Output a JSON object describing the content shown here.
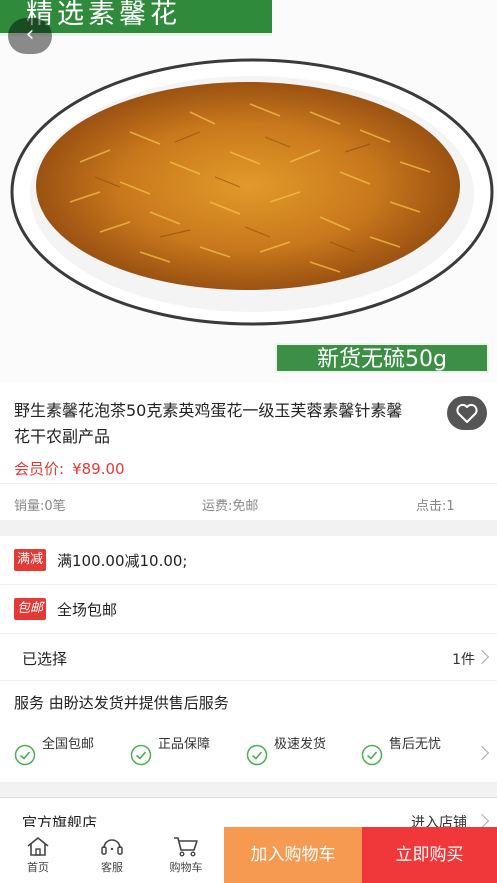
{
  "hero": {
    "banner_text": "精选素馨花",
    "caption": "新货无硫50g"
  },
  "product": {
    "title": "野生素馨花泡茶50克素英鸡蛋花一级玉芙蓉素馨针素馨花干农副产品",
    "price_label": "会员价:",
    "price_value": "¥89.00",
    "sales": "销量:0笔",
    "shipping": "运费:免邮",
    "clicks": "点击:1"
  },
  "promos": [
    {
      "tag": "满减",
      "text": "满100.00减10.00;"
    },
    {
      "tag": "包邮",
      "text": "全场包邮"
    }
  ],
  "selection": {
    "label": "已选择",
    "value": "1件"
  },
  "service": {
    "text": "服务 由盼达发货并提供售后服务"
  },
  "features": [
    "全国包邮",
    "正品保障",
    "极速发货",
    "售后无忧"
  ],
  "shop": {
    "name": "官方旗舰店",
    "enter": "进入店铺"
  },
  "bottom_nav": [
    {
      "label": "首页",
      "icon": "home-icon"
    },
    {
      "label": "客服",
      "icon": "headset-icon"
    },
    {
      "label": "购物车",
      "icon": "cart-icon"
    }
  ],
  "actions": {
    "add_to_cart": "加入购物车",
    "buy_now": "立即购买"
  },
  "colors": {
    "accent_red": "#f0383a",
    "accent_orange": "#f59a50",
    "banner_green": "#2f8a3c",
    "check_green": "#4caf50"
  }
}
